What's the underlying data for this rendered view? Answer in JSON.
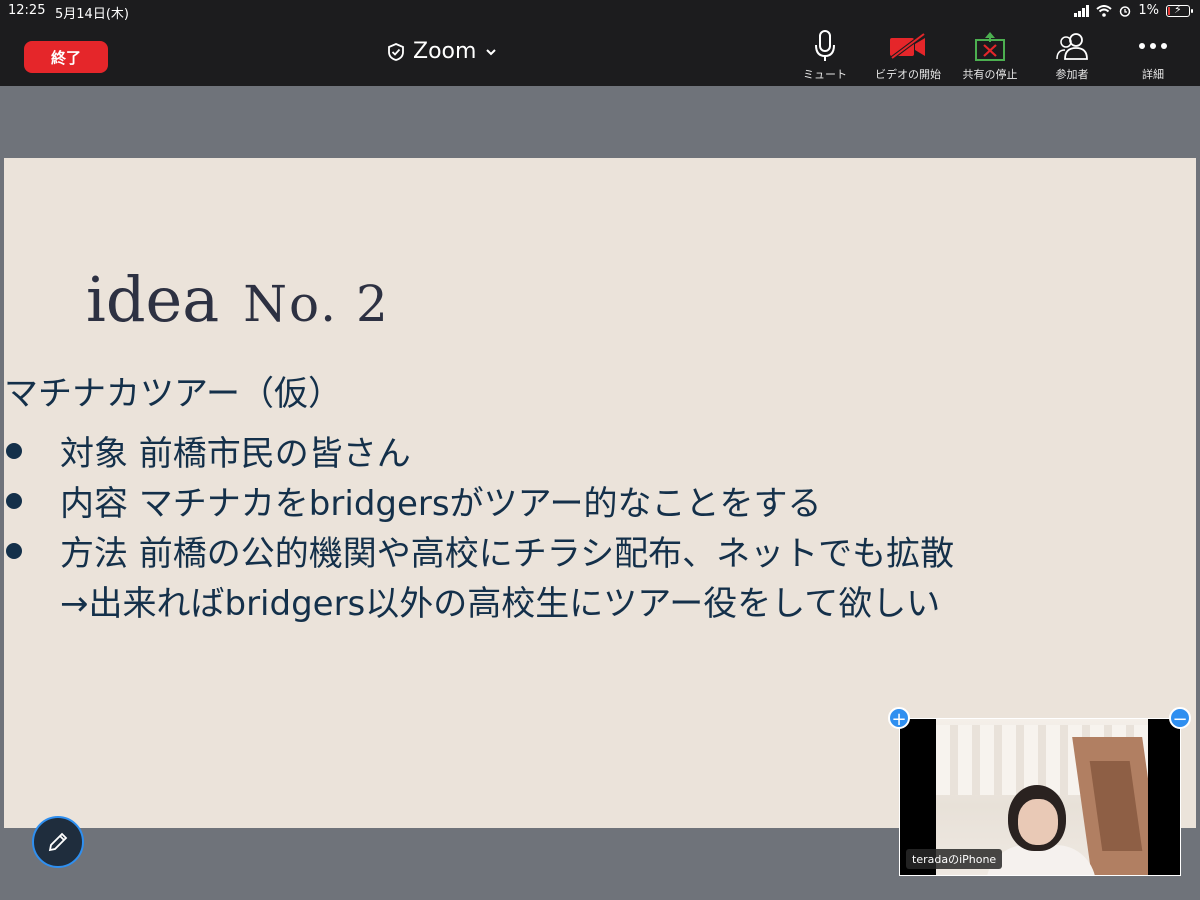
{
  "status_bar": {
    "time": "12:25",
    "date": "5月14日(木)",
    "battery": "1%"
  },
  "toolbar": {
    "end_label": "終了",
    "meeting_title": "Zoom",
    "items": [
      {
        "label": "ミュート",
        "icon": "microphone-icon"
      },
      {
        "label": "ビデオの開始",
        "icon": "video-off-icon"
      },
      {
        "label": "共有の停止",
        "icon": "stop-share-icon"
      },
      {
        "label": "参加者",
        "icon": "participants-icon"
      },
      {
        "label": "詳細",
        "icon": "more-icon"
      }
    ]
  },
  "slide": {
    "title_word": "idea",
    "title_num": "No. 2",
    "subtitle": "マチナカツアー（仮）",
    "bullets": [
      "対象 前橋市民の皆さん",
      "内容 マチナカをbridgersがツアー的なことをする",
      "方法  前橋の公的機関や高校にチラシ配布、ネットでも拡散"
    ],
    "note": "→出来ればbridgers以外の高校生にツアー役をして欲しい"
  },
  "video": {
    "participant_label": "teradaのiPhone"
  },
  "colors": {
    "end_button": "#e5262a",
    "toolbar_bg": "#1c1c1e",
    "slide_bg": "#ebe3da",
    "slide_text": "#14304a",
    "accent_blue": "#2f8ff0"
  }
}
